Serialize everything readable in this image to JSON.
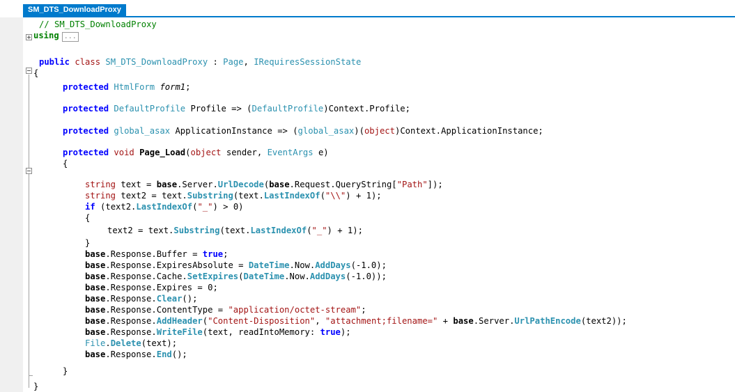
{
  "tab": {
    "title": "SM_DTS_DownloadProxy"
  },
  "code": {
    "comment": "// SM_DTS_DownloadProxy",
    "using_keyword": "using",
    "collapsed_box": "...",
    "public": "public",
    "class": "class",
    "class_name": "SM_DTS_DownloadProxy",
    "colon": " : ",
    "base_page": "Page",
    "comma": ", ",
    "interface": "IRequiresSessionState",
    "open_brace": "{",
    "close_brace": "}",
    "protected": "protected",
    "htmlform": "HtmlForm",
    "form1": "form1",
    "semicolon": ";",
    "default_profile": "DefaultProfile",
    "profile_prop": " Profile => (",
    "context_profile": ")Context.Profile;",
    "global_asax": "global_asax",
    "app_prop": " ApplicationInstance => (",
    "object_kw": "object",
    "app_tail": ")Context.ApplicationInstance;",
    "void_kw": "void",
    "page_load": "Page_Load",
    "sender_tail": " sender, ",
    "eventargs": "EventArgs",
    "e_tail": " e)",
    "string_kw": "string",
    "l1_a": " text = ",
    "base_kw": "base",
    "l1_b": ".Server.",
    "urldecode": "UrlDecode",
    "l1_c": ".Request.QueryString[",
    "path_str": "\"Path\"",
    "l1_d": "]);",
    "l2_a": " text2 = text.",
    "substring": "Substring",
    "l2_b": "(text.",
    "lastindexof": "LastIndexOf",
    "backslash_str": "\"\\\\\"",
    "l2_c": ") + 1);",
    "if_kw": "if",
    "l3_a": " (text2.",
    "underscore_str": "\"_\"",
    "l3_b": ") > 0)",
    "l4_a": "text2 = text.",
    "l5_a": ".Response.Buffer = ",
    "true_kw": "true",
    "l6_a": ".Response.ExpiresAbsolute = ",
    "datetime": "DateTime",
    "now_dot": ".Now.",
    "adddays": "AddDays",
    "minus_one": "(-1.0);",
    "l7_a": ".Response.Cache.",
    "setexpires": "SetExpires",
    "paren_open": "(",
    "minus_one_close": "(-1.0));",
    "l8_a": ".Response.Expires = 0;",
    "l9_a": ".Response.",
    "clear": "Clear",
    "call_end": "();",
    "l10_a": ".Response.ContentType = ",
    "octet_str": "\"application/octet-stream\"",
    "addheader": "AddHeader",
    "cd_str": "\"Content-Disposition\"",
    "attach_str": "\"attachment;filename=\"",
    "plus": " + ",
    "urlpathencode": "UrlPathEncode",
    "l11_tail": "(text2));",
    "writefile": "WriteFile",
    "l12_tail": "(text, readIntoMemory: ",
    "close_semi": ");",
    "file_cls": "File",
    "dot": ".",
    "delete": "Delete",
    "l13_tail": "(text);",
    "end": "End"
  }
}
